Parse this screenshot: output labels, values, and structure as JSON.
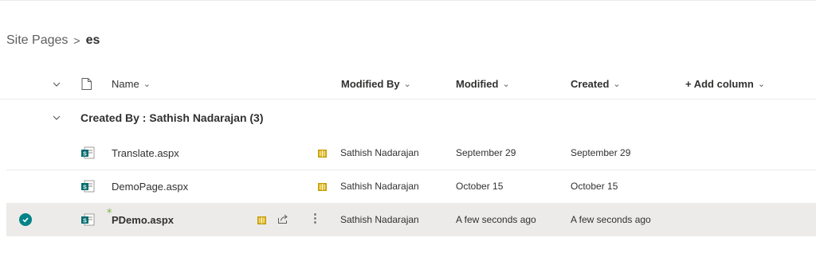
{
  "breadcrumb": {
    "root": "Site Pages",
    "separator": ">",
    "current": "es"
  },
  "columns": {
    "name": "Name",
    "modified_by": "Modified By",
    "modified": "Modified",
    "created": "Created",
    "add_column": "+ Add column"
  },
  "group": {
    "title": "Created By : Sathish Nadarajan (3)"
  },
  "rows": [
    {
      "name": "Translate.aspx",
      "modified_by": "Sathish Nadarajan",
      "modified": "September 29",
      "created": "September 29",
      "selected": false
    },
    {
      "name": "DemoPage.aspx",
      "modified_by": "Sathish Nadarajan",
      "modified": "October 15",
      "created": "October 15",
      "selected": false
    },
    {
      "name": "PDemo.aspx",
      "modified_by": "Sathish Nadarajan",
      "modified": "A few seconds ago",
      "created": "A few seconds ago",
      "selected": true
    }
  ],
  "colors": {
    "accent": "#038387",
    "sharepoint_icon": "#036c70",
    "book_icon": "#c19c00",
    "selected_row": "#ecebe9",
    "new_marker": "#8fbc5a"
  },
  "icons": [
    "chevron-down-icon",
    "document-icon",
    "sharepoint-page-icon",
    "book-icon",
    "share-icon",
    "more-icon",
    "check-circle-icon"
  ]
}
